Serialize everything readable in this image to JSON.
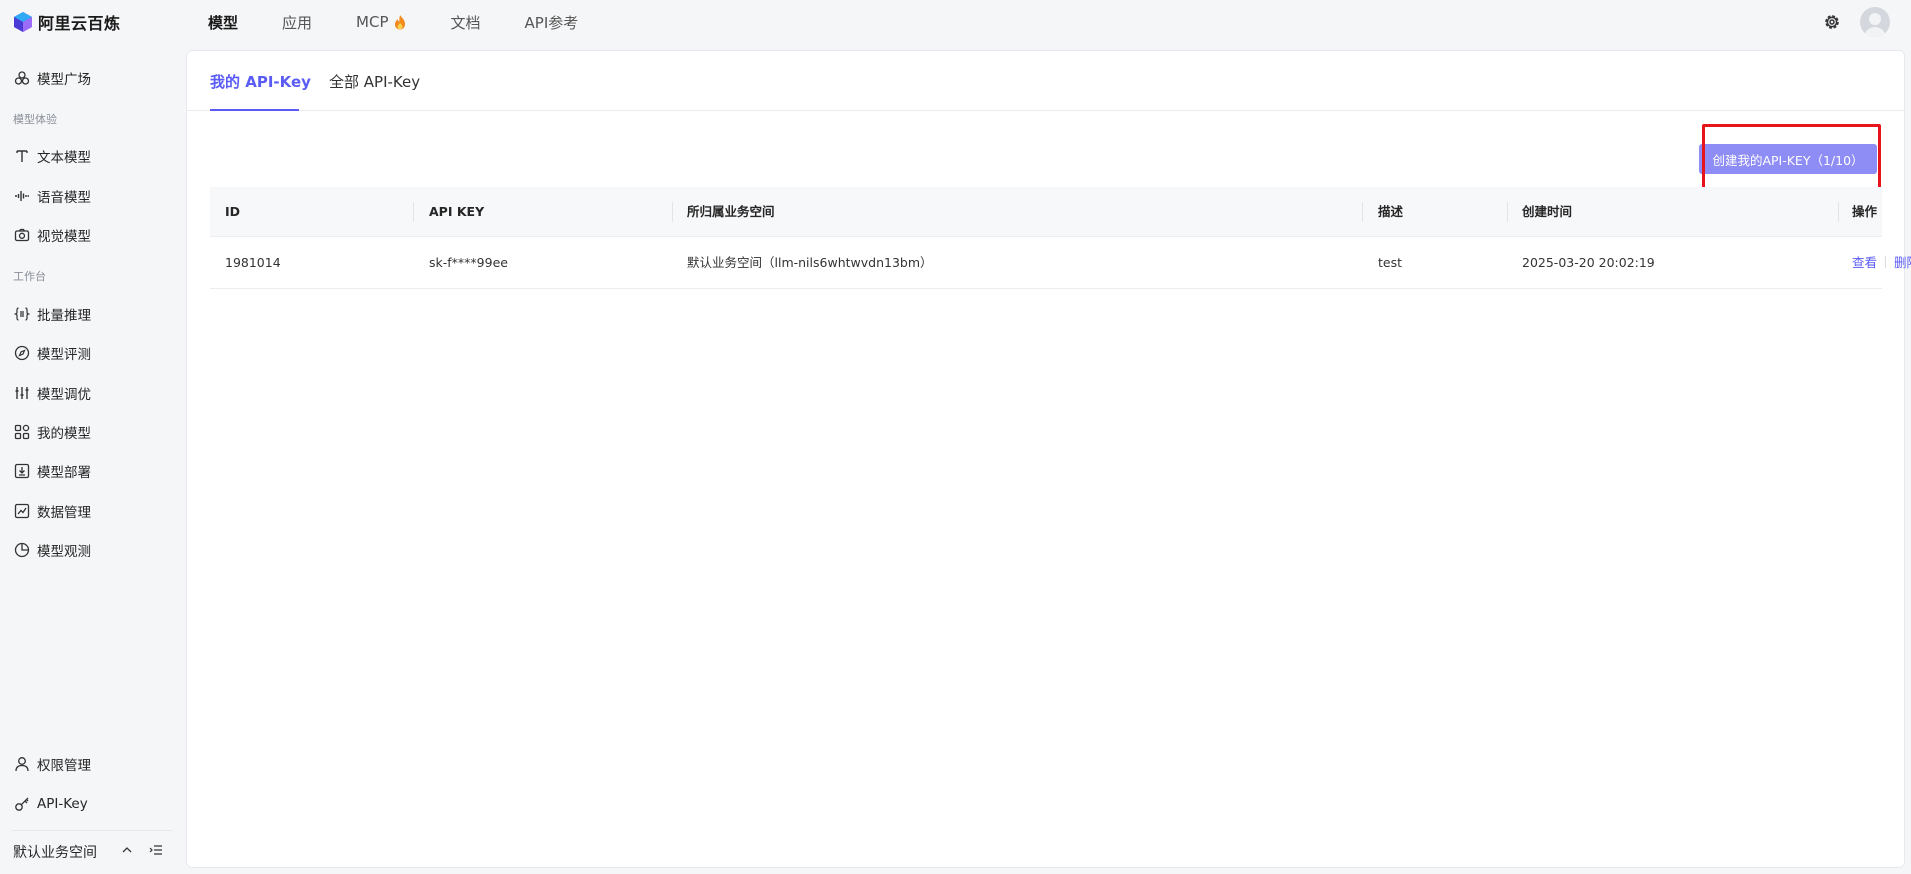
{
  "app": {
    "logo_text": "阿里云百炼"
  },
  "topnav": {
    "items": [
      {
        "label": "模型",
        "active": true
      },
      {
        "label": "应用",
        "active": false
      },
      {
        "label": "MCP",
        "active": false
      },
      {
        "label": "文档",
        "active": false
      },
      {
        "label": "API参考",
        "active": false
      }
    ]
  },
  "sidebar": {
    "model_square": "模型广场",
    "group_experience": "模型体验",
    "text_model": "文本模型",
    "voice_model": "语音模型",
    "vision_model": "视觉模型",
    "group_workbench": "工作台",
    "batch_inference": "批量推理",
    "model_eval": "模型评测",
    "model_tuning": "模型调优",
    "my_models": "我的模型",
    "model_deploy": "模型部署",
    "data_manage": "数据管理",
    "model_observe": "模型观测",
    "permission": "权限管理",
    "api_key": "API-Key",
    "workspace": "默认业务空间"
  },
  "main": {
    "tabs": [
      {
        "label": "我的 API-Key",
        "active": true
      },
      {
        "label": "全部 API-Key",
        "active": false
      }
    ],
    "create_button": "创建我的API-KEY（1/10）",
    "table": {
      "headers": [
        "ID",
        "API KEY",
        "所归属业务空间",
        "描述",
        "创建时间",
        "操作"
      ],
      "rows": [
        {
          "id": "1981014",
          "api_key": "sk-f****99ee",
          "workspace": "默认业务空间（llm-nils6whtwvdn13bm）",
          "desc": "test",
          "created": "2025-03-20 20:02:19",
          "action_view": "查看",
          "action_delete": "删除"
        }
      ]
    }
  },
  "colors": {
    "accent": "#5b5bf5",
    "button": "#8e8cf5",
    "highlight": "#e8141b"
  }
}
